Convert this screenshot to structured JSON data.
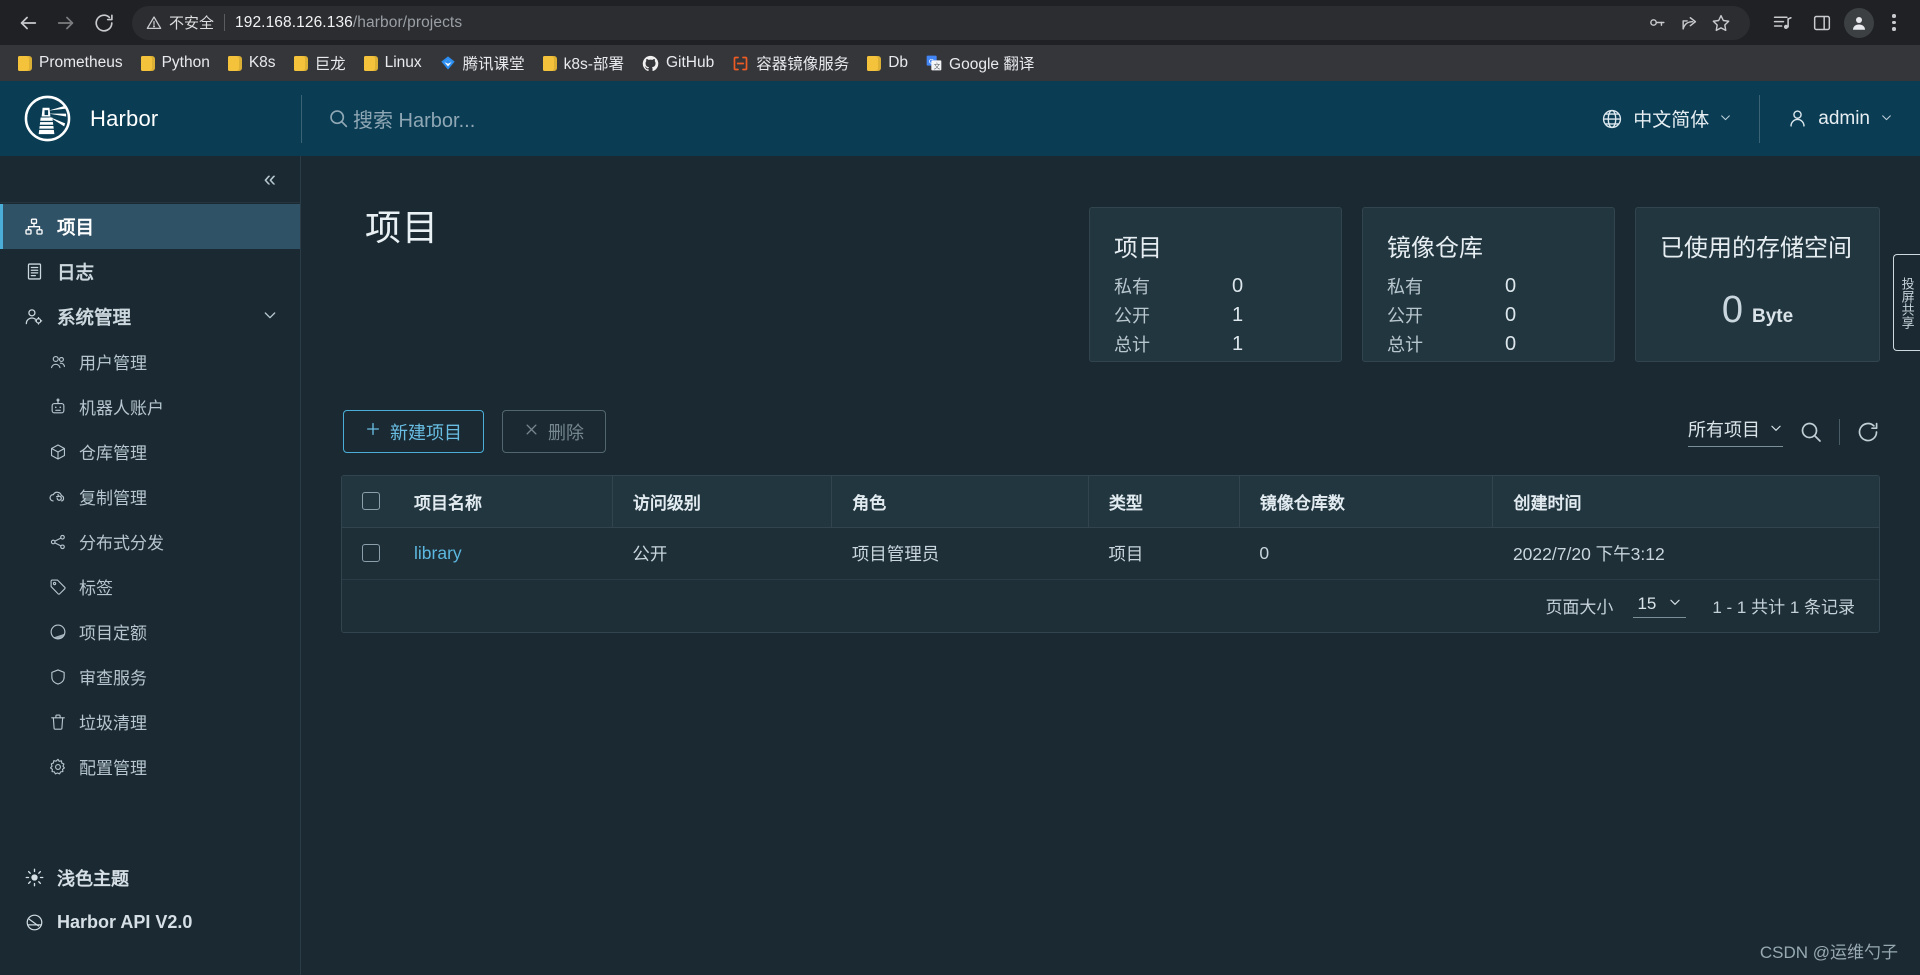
{
  "browser": {
    "nav": {
      "back": "back-arrow",
      "forward": "forward-arrow",
      "reload": "reload-arrow"
    },
    "omnibox": {
      "security_label": "不安全",
      "url_host": "192.168.126.136",
      "url_path": "/harbor/projects",
      "full_url": "192.168.126.136/harbor/projects"
    },
    "toolbar_icons": [
      "key-icon",
      "share-icon",
      "star-icon",
      "media-playlist-icon",
      "side-panel-icon",
      "profile-avatar-icon",
      "kebab-menu-icon"
    ],
    "bookmarks": [
      {
        "label": "Prometheus",
        "icon": "folder-icon"
      },
      {
        "label": "Python",
        "icon": "folder-icon"
      },
      {
        "label": "K8s",
        "icon": "folder-icon"
      },
      {
        "label": "巨龙",
        "icon": "folder-icon"
      },
      {
        "label": "Linux",
        "icon": "folder-icon"
      },
      {
        "label": "腾讯课堂",
        "icon": "tencent-diamond-icon"
      },
      {
        "label": "k8s-部署",
        "icon": "folder-icon"
      },
      {
        "label": "GitHub",
        "icon": "github-icon"
      },
      {
        "label": "容器镜像服务",
        "icon": "aliyun-acr-icon"
      },
      {
        "label": "Db",
        "icon": "folder-icon"
      },
      {
        "label": "Google 翻译",
        "icon": "google-translate-icon"
      }
    ]
  },
  "header": {
    "brand": "Harbor",
    "logo_icon": "harbor-lighthouse-logo",
    "search_placeholder": "搜索 Harbor...",
    "search_icon": "search-icon",
    "language": "中文简体",
    "language_icon": "globe-icon",
    "user": "admin",
    "user_icon": "user-icon",
    "caret_icon": "chevron-down-icon"
  },
  "sidebar": {
    "collapse_icon": "«",
    "items": [
      {
        "label": "项目",
        "icon": "projects-icon",
        "active": true
      },
      {
        "label": "日志",
        "icon": "logs-icon",
        "active": false
      },
      {
        "label": "系统管理",
        "icon": "administration-icon",
        "active": false,
        "expanded": true
      }
    ],
    "subitems": [
      {
        "label": "用户管理",
        "icon": "users-icon"
      },
      {
        "label": "机器人账户",
        "icon": "robot-icon"
      },
      {
        "label": "仓库管理",
        "icon": "registry-cube-icon"
      },
      {
        "label": "复制管理",
        "icon": "replication-cloud-icon"
      },
      {
        "label": "分布式分发",
        "icon": "distribution-share-icon"
      },
      {
        "label": "标签",
        "icon": "tag-icon"
      },
      {
        "label": "项目定额",
        "icon": "quota-pie-icon"
      },
      {
        "label": "审查服务",
        "icon": "shield-icon"
      },
      {
        "label": "垃圾清理",
        "icon": "trash-icon"
      },
      {
        "label": "配置管理",
        "icon": "gear-icon"
      }
    ],
    "bottom": [
      {
        "label": "浅色主题",
        "icon": "sun-icon"
      },
      {
        "label": "Harbor API V2.0",
        "icon": "api-icon"
      }
    ]
  },
  "main": {
    "page_title": "项目",
    "stat_cards": [
      {
        "title": "项目",
        "rows": [
          {
            "label": "私有",
            "value": "0"
          },
          {
            "label": "公开",
            "value": "1"
          },
          {
            "label": "总计",
            "value": "1"
          }
        ]
      },
      {
        "title": "镜像仓库",
        "rows": [
          {
            "label": "私有",
            "value": "0"
          },
          {
            "label": "公开",
            "value": "0"
          },
          {
            "label": "总计",
            "value": "0"
          }
        ]
      }
    ],
    "storage_card": {
      "title": "已使用的存储空间",
      "value": "0",
      "unit": "Byte"
    },
    "toolbar": {
      "new_project_label": "新建项目",
      "new_project_icon": "plus-icon",
      "delete_label": "删除",
      "delete_icon": "close-x-icon",
      "filter_value": "所有项目",
      "filter_caret_icon": "chevron-down-icon",
      "search_icon": "search-icon",
      "refresh_icon": "refresh-icon"
    },
    "table": {
      "columns": [
        "项目名称",
        "访问级别",
        "角色",
        "类型",
        "镜像仓库数",
        "创建时间"
      ],
      "rows": [
        {
          "name": "library",
          "access_level": "公开",
          "role": "项目管理员",
          "type": "项目",
          "repo_count": "0",
          "created": "2022/7/20 下午3:12"
        }
      ]
    },
    "pagination": {
      "page_size_label": "页面大小",
      "page_size_value": "15",
      "caret_icon": "chevron-down-icon",
      "range_text": "1 - 1 共计 1 条记录"
    },
    "float_tab": "投屏共享",
    "watermark": "CSDN @运维勺子"
  },
  "colors": {
    "header_bg": "#0a3c54",
    "app_bg": "#1b2a32",
    "accent": "#4aaed9",
    "link": "#5cb8e0",
    "nav_active_bg": "#2f5266",
    "card_bg": "#223640",
    "bookmark_folder": "#f5c33b"
  }
}
